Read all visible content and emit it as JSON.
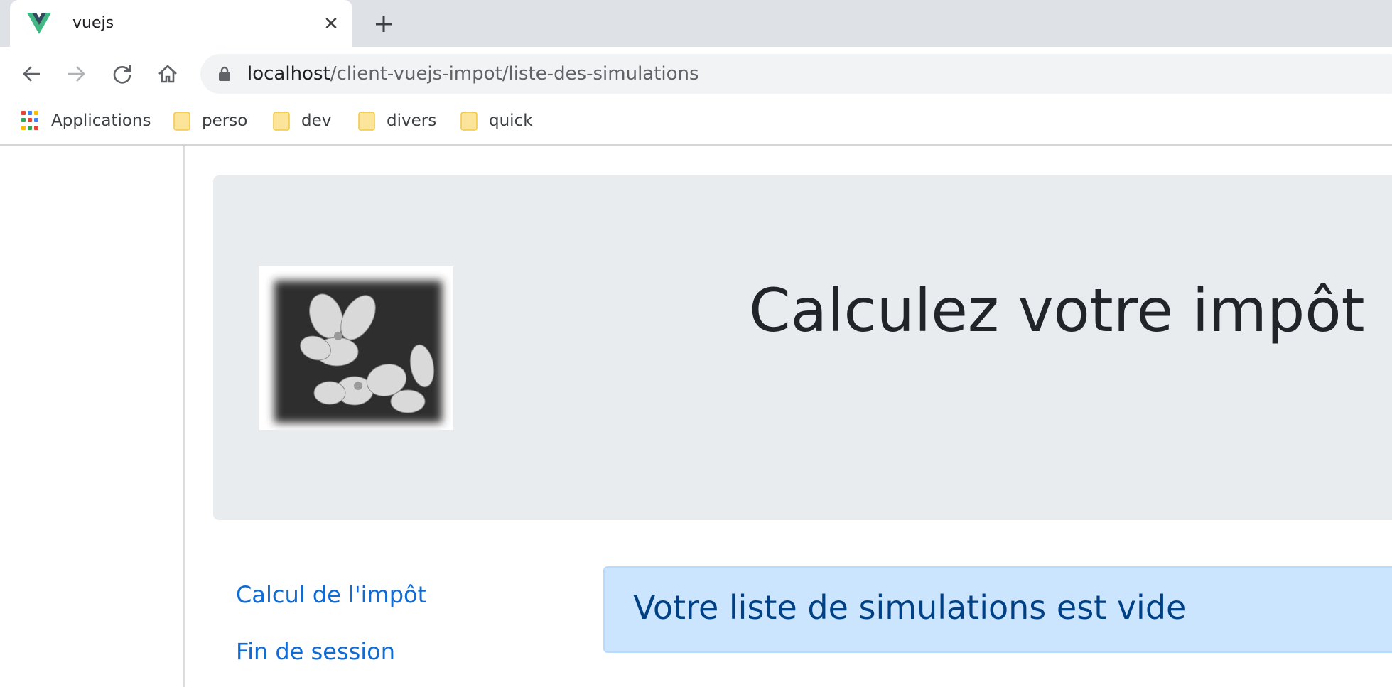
{
  "browser": {
    "tab": {
      "title": "vuejs",
      "close_label": "✕",
      "favicon": "vue-logo-icon"
    },
    "new_tab_label": "+",
    "url": {
      "host": "localhost",
      "path": "/client-vuejs-impot/liste-des-simulations"
    },
    "bookmarks": [
      {
        "label": "Applications",
        "icon": "apps-grid-icon"
      },
      {
        "label": "perso",
        "icon": "folder-icon"
      },
      {
        "label": "dev",
        "icon": "folder-icon"
      },
      {
        "label": "divers",
        "icon": "folder-icon"
      },
      {
        "label": "quick",
        "icon": "folder-icon"
      }
    ]
  },
  "page": {
    "title": "Calculez votre impôt",
    "logo": "flower-photo-image",
    "menu": [
      {
        "label": "Calcul de l'impôt"
      },
      {
        "label": "Fin de session"
      }
    ],
    "alert": {
      "text": "Votre liste de simulations est vide"
    }
  },
  "colors": {
    "jumbotron_bg": "#e9ecef",
    "link": "#0f6bd6",
    "alert_bg": "#cce5ff",
    "alert_border": "#b8daff",
    "alert_text": "#004085",
    "vue_green": "#41b883",
    "vue_dark": "#35495e"
  }
}
